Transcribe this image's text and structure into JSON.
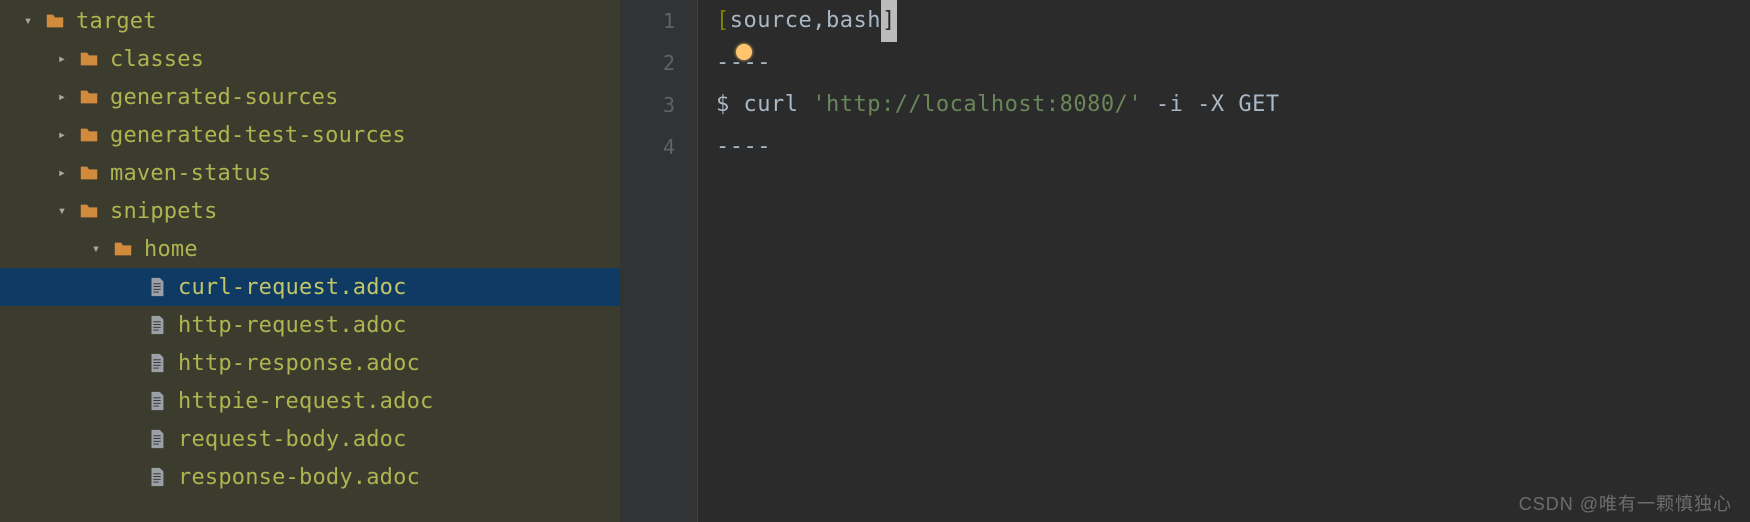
{
  "tree": {
    "rows": [
      {
        "indent": 18,
        "expander": "down",
        "icon": "folder",
        "label": "target",
        "selected": false
      },
      {
        "indent": 52,
        "expander": "right",
        "icon": "folder",
        "label": "classes",
        "selected": false
      },
      {
        "indent": 52,
        "expander": "right",
        "icon": "folder",
        "label": "generated-sources",
        "selected": false
      },
      {
        "indent": 52,
        "expander": "right",
        "icon": "folder",
        "label": "generated-test-sources",
        "selected": false
      },
      {
        "indent": 52,
        "expander": "right",
        "icon": "folder",
        "label": "maven-status",
        "selected": false
      },
      {
        "indent": 52,
        "expander": "down",
        "icon": "folder",
        "label": "snippets",
        "selected": false
      },
      {
        "indent": 86,
        "expander": "down",
        "icon": "folder",
        "label": "home",
        "selected": false
      },
      {
        "indent": 120,
        "expander": "none",
        "icon": "file",
        "label": "curl-request.adoc",
        "selected": true
      },
      {
        "indent": 120,
        "expander": "none",
        "icon": "file",
        "label": "http-request.adoc",
        "selected": false
      },
      {
        "indent": 120,
        "expander": "none",
        "icon": "file",
        "label": "http-response.adoc",
        "selected": false
      },
      {
        "indent": 120,
        "expander": "none",
        "icon": "file",
        "label": "httpie-request.adoc",
        "selected": false
      },
      {
        "indent": 120,
        "expander": "none",
        "icon": "file",
        "label": "request-body.adoc",
        "selected": false
      },
      {
        "indent": 120,
        "expander": "none",
        "icon": "file",
        "label": "response-body.adoc",
        "selected": false
      }
    ]
  },
  "editor": {
    "gutter": [
      "1",
      "2",
      "3",
      "4"
    ],
    "line1": {
      "open": "[",
      "mid": "source,bash",
      "close": "]"
    },
    "line2": "----",
    "line3": {
      "prefix": "$ curl ",
      "str": "'http://localhost:8080/'",
      "suffix": " -i -X GET"
    },
    "line4": "----"
  },
  "watermark": "CSDN @唯有一颗慎独心"
}
